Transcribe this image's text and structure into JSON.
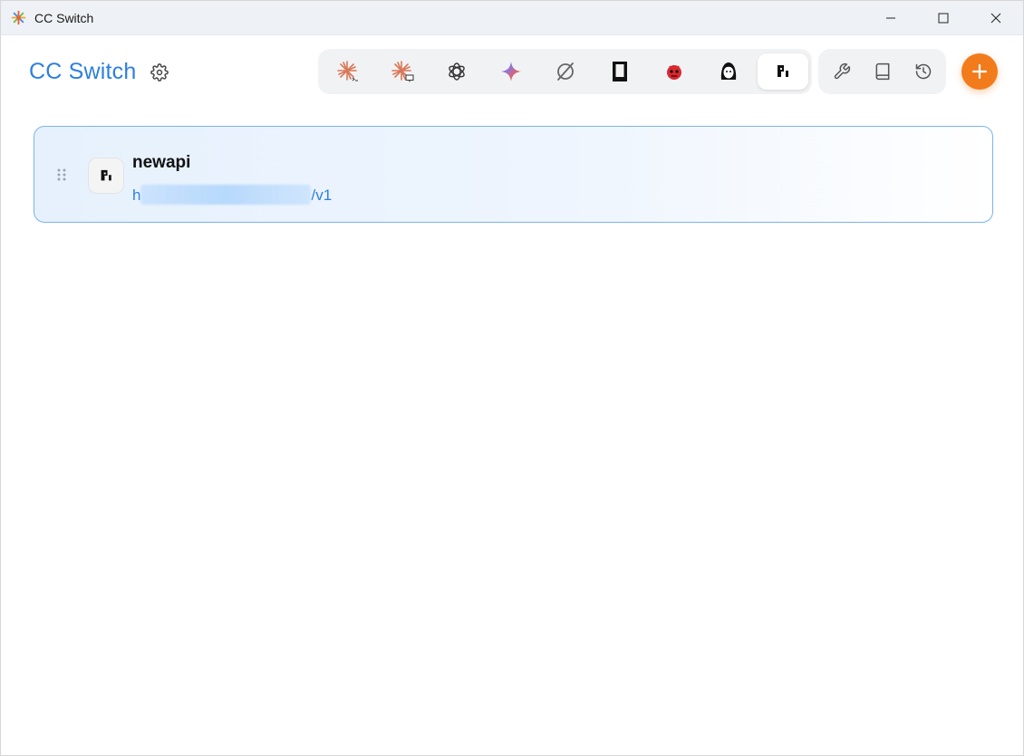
{
  "window": {
    "title": "CC Switch",
    "controls": [
      "minimize",
      "maximize",
      "close"
    ]
  },
  "header": {
    "brand": "CC Switch",
    "settings_icon": "gear-icon",
    "app_tabs": [
      {
        "id": "claude-code",
        "icon": "claude-terminal-icon",
        "active": false
      },
      {
        "id": "claude-desktop",
        "icon": "claude-desktop-icon",
        "active": false
      },
      {
        "id": "codex",
        "icon": "openai-icon",
        "active": false
      },
      {
        "id": "gemini",
        "icon": "gemini-icon",
        "active": false
      },
      {
        "id": "opencode",
        "icon": "opencode-icon",
        "active": false
      },
      {
        "id": "kiro",
        "icon": "terminal-box-icon",
        "active": false
      },
      {
        "id": "droid",
        "icon": "red-bot-icon",
        "active": false
      },
      {
        "id": "qwen",
        "icon": "character-avatar-icon",
        "active": false
      },
      {
        "id": "newapi",
        "icon": "newapi-logo-icon",
        "active": true
      }
    ],
    "tools": [
      {
        "id": "tools",
        "icon": "wrench-icon"
      },
      {
        "id": "docs",
        "icon": "book-icon"
      },
      {
        "id": "history",
        "icon": "history-icon"
      }
    ],
    "add_icon": "plus-icon"
  },
  "colors": {
    "accent": "#2d7fe0",
    "add_button": "#f27b1b",
    "card_border": "#79b4ee",
    "card_bg": "#e6f1fd"
  },
  "providers": [
    {
      "name": "newapi",
      "url_prefix": "h",
      "url_suffix": "/v1",
      "url_redacted": true,
      "icon": "newapi-logo-icon",
      "active": true
    }
  ]
}
